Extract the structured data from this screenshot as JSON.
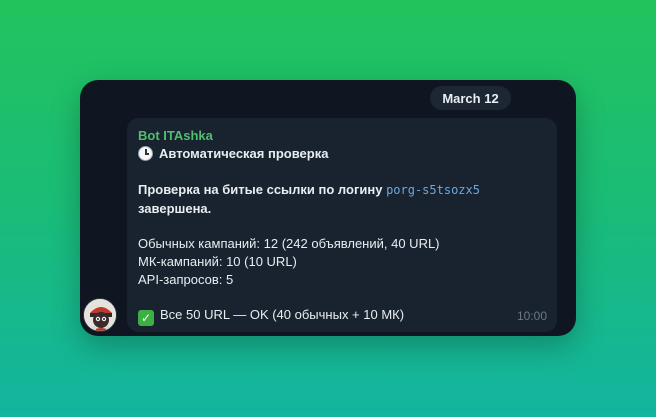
{
  "chat": {
    "date": "March 12",
    "sender": "Bot ITAshka",
    "heading": "Автоматическая проверка",
    "body_line1_prefix": "Проверка на битые ссылки по логину ",
    "login": "porg-s5tsozx5",
    "body_line1_suffix": "завершена.",
    "stats": [
      "Обычных кампаний: 12 (242 объявлений, 40 URL)",
      "МК-кампаний: 10 (10 URL)",
      "API-запросов: 5"
    ],
    "result": "Все 50 URL — OK (40 обычных + 10 МК)",
    "time": "10:00"
  },
  "icons": {
    "heading_icon": "clock-icon",
    "result_icon": "check-mark-icon",
    "avatar": "bot-avatar"
  },
  "colors": {
    "background_top": "#22c35d",
    "background_bottom": "#13b4a0",
    "window": "#0f1621",
    "bubble": "#19232f",
    "sender": "#4fbf6f",
    "code": "#6aa8e0"
  }
}
